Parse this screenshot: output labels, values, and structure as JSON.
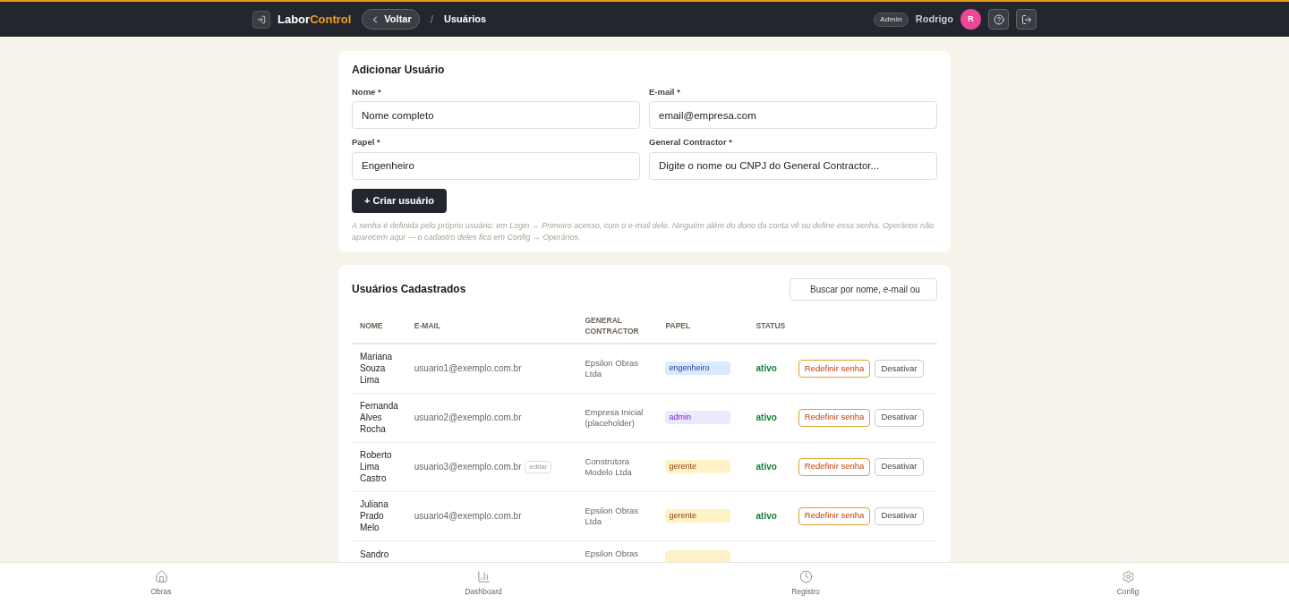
{
  "header": {
    "logo": {
      "part1": "Labor",
      "part2": "Control"
    },
    "back_button": "Voltar",
    "separator": "/",
    "page_title": "Usuários",
    "role_badge": "Admin",
    "user_name": "Rodrigo",
    "avatar_initial": "R"
  },
  "add_user": {
    "title": "Adicionar Usuário",
    "fields": [
      {
        "label": "Nome *",
        "placeholder": "Nome completo"
      },
      {
        "label": "E-mail *",
        "placeholder": "email@empresa.com"
      },
      {
        "label": "Papel *",
        "value": "Engenheiro"
      },
      {
        "label": "General Contractor *",
        "placeholder": "Digite o nome ou CNPJ do General Contractor..."
      }
    ],
    "submit": "+ Criar usuário",
    "note": "A senha é definida pelo próprio usuário: em Login → Primeiro acesso, com o e-mail dele. Ninguém além do dono da conta vê ou define essa senha. Operários não aparecem aqui — o cadastro deles fica em Config → Operários."
  },
  "users": {
    "title": "Usuários Cadastrados",
    "search": {
      "placeholder": "Buscar por nome, e-mail ou"
    },
    "columns": [
      "NOME",
      "E-MAIL",
      "GENERAL CONTRACTOR",
      "PAPEL",
      "STATUS"
    ],
    "rows": [
      {
        "name": "Mariana Souza Lima",
        "email": "usuario1@exemplo.com.br",
        "gc": "Epsilon Obras Ltda",
        "role": {
          "kind": "engenheiro",
          "label": "engenheiro"
        },
        "status": "ativo",
        "buttons": [
          "Redefinir senha",
          "Desativar"
        ]
      },
      {
        "name": "Fernanda Alves Rocha",
        "email": "usuario2@exemplo.com.br",
        "gc": "Empresa Inicial (placeholder)",
        "role": {
          "kind": "admin",
          "label": "admin"
        },
        "status": "ativo",
        "buttons": [
          "Redefinir senha",
          "Desativar"
        ]
      },
      {
        "name": "Roberto Lima Castro",
        "email": "usuario3@exemplo.com.br",
        "edit": "editar",
        "gc": "Construtora Modelo Ltda",
        "role": {
          "kind": "gerente",
          "label": "gerente"
        },
        "status": "ativo",
        "buttons": [
          "Redefinir senha",
          "Desativar"
        ]
      },
      {
        "name": "Juliana Prado Melo",
        "email": "usuario4@exemplo.com.br",
        "gc": "Epsilon Obras Ltda",
        "role": {
          "kind": "gerente",
          "label": "gerente"
        },
        "status": "ativo",
        "buttons": [
          "Redefinir senha",
          "Desativar"
        ]
      },
      {
        "name": "Sandro",
        "gc": "Epsilon Obras",
        "role": {
          "kind": "gerente"
        }
      }
    ]
  },
  "bottom_nav": [
    {
      "kind": "home",
      "label": "Obras"
    },
    {
      "kind": "chart",
      "label": "Dashboard"
    },
    {
      "kind": "clock",
      "label": "Registro"
    },
    {
      "kind": "gear",
      "label": "Config"
    }
  ]
}
